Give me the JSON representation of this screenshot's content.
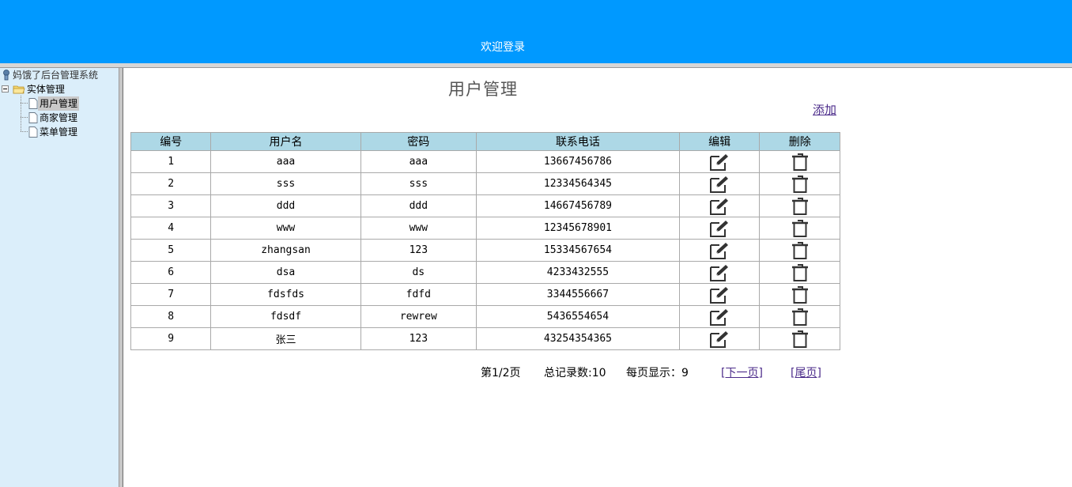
{
  "header": {
    "welcome": "欢迎登录",
    "bg_color": "#0099ff"
  },
  "sidebar": {
    "root": "妈饿了后台管理系统",
    "group": "实体管理",
    "items": [
      "用户管理",
      "商家管理",
      "菜单管理"
    ],
    "selected": "用户管理",
    "bg_color": "#dbeefa"
  },
  "main": {
    "title": "用户管理",
    "add_link": "添加",
    "table": {
      "headers": [
        "编号",
        "用户名",
        "密码",
        "联系电话",
        "编辑",
        "删除"
      ],
      "header_color": "#add8e6",
      "rows": [
        {
          "id": "1",
          "username": "aaa",
          "password": "aaa",
          "phone": "13667456786"
        },
        {
          "id": "2",
          "username": "sss",
          "password": "sss",
          "phone": "12334564345"
        },
        {
          "id": "3",
          "username": "ddd",
          "password": "ddd",
          "phone": "14667456789"
        },
        {
          "id": "4",
          "username": "www",
          "password": "www",
          "phone": "12345678901"
        },
        {
          "id": "5",
          "username": "zhangsan",
          "password": "123",
          "phone": "15334567654"
        },
        {
          "id": "6",
          "username": "dsa",
          "password": "ds",
          "phone": "4233432555"
        },
        {
          "id": "7",
          "username": "fdsfds",
          "password": "fdfd",
          "phone": "3344556667"
        },
        {
          "id": "8",
          "username": "fdsdf",
          "password": "rewrew",
          "phone": "5436554654"
        },
        {
          "id": "9",
          "username": "张三",
          "password": "123",
          "phone": "43254354365"
        }
      ],
      "edit_icon": "edit-pencil-icon",
      "delete_icon": "trash-icon"
    },
    "pager": {
      "page_info": "第1/2页",
      "total": "总记录数:10",
      "per_page": "每页显示：9",
      "next": "[下一页]",
      "last": "[尾页]"
    }
  }
}
